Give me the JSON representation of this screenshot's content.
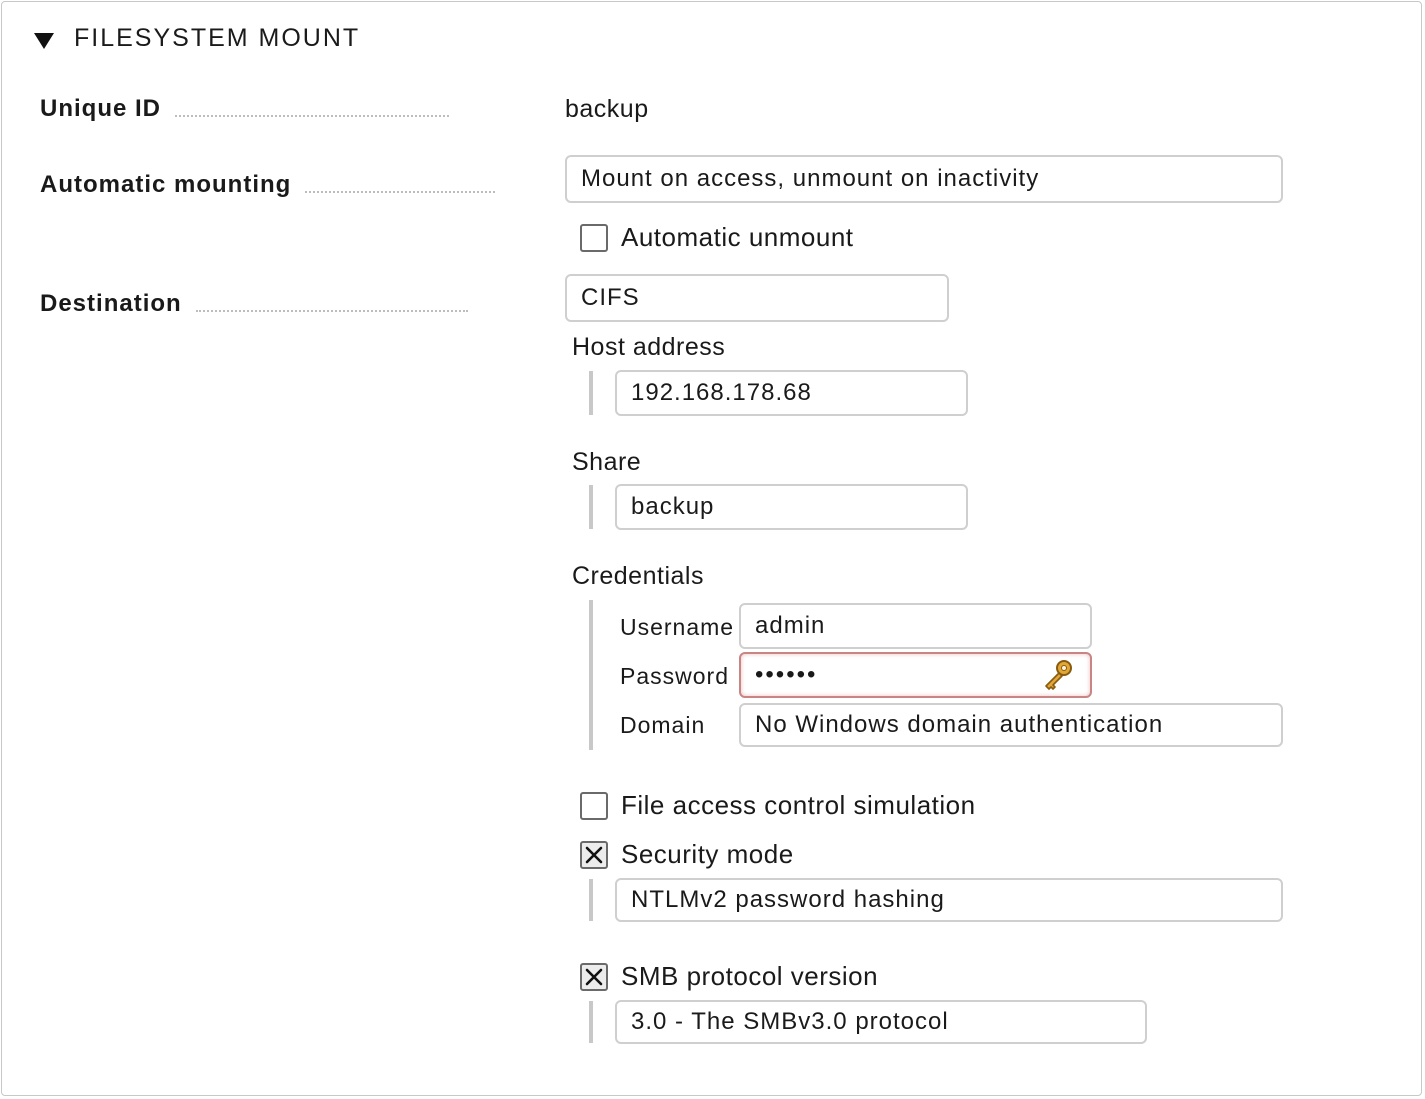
{
  "section": {
    "title": "FILESYSTEM MOUNT"
  },
  "fields": {
    "unique_id": {
      "label": "Unique ID",
      "value": "backup"
    },
    "automatic_mounting": {
      "label": "Automatic mounting",
      "value": "Mount on access, unmount on inactivity",
      "automatic_unmount": {
        "label": "Automatic unmount",
        "checked": false
      }
    },
    "destination": {
      "label": "Destination",
      "value": "CIFS",
      "host_address": {
        "label": "Host address",
        "value": "192.168.178.68"
      },
      "share": {
        "label": "Share",
        "value": "backup"
      },
      "credentials": {
        "label": "Credentials",
        "username": {
          "label": "Username",
          "value": "admin"
        },
        "password": {
          "label": "Password",
          "value": "••••••"
        },
        "domain": {
          "label": "Domain",
          "value": "No Windows domain authentication"
        }
      },
      "file_access_control": {
        "label": "File access control simulation",
        "checked": false
      },
      "security_mode": {
        "label": "Security mode",
        "checked": true,
        "value": "NTLMv2 password hashing"
      },
      "smb_protocol": {
        "label": "SMB protocol version",
        "checked": true,
        "value": "3.0 - The SMBv3.0 protocol"
      }
    }
  },
  "icons": {
    "collapse": "triangle-down-icon",
    "password_key": "key-icon",
    "check": "x-check-icon"
  },
  "colors": {
    "field_border": "#cfcfcf",
    "password_border": "#c98484",
    "checkbox_border": "#6a6a6a"
  }
}
